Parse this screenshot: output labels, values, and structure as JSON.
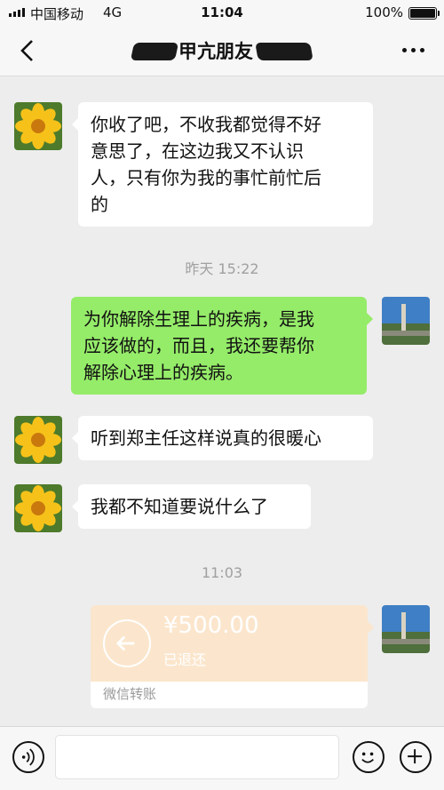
{
  "status_bar": {
    "carrier": "中国移动",
    "network": "4G",
    "time": "11:04",
    "battery_percent": "100%",
    "battery_level": 1.0
  },
  "nav": {
    "title": "甲亢朋友",
    "back_icon": "chevron-left-icon",
    "more_icon": "more-dots-icon"
  },
  "messages": [
    {
      "side": "left",
      "avatar": "sunflower-avatar",
      "text_lines": [
        "你收了吧，不收我都觉得不好",
        "意思了，在这边我又不认识",
        "人，只有你为我的事忙前忙后",
        "的"
      ]
    },
    {
      "type": "timestamp",
      "text": "昨天 15:22"
    },
    {
      "side": "right",
      "avatar": "tower-avatar",
      "text_lines": [
        "为你解除生理上的疾病，是我",
        "应该做的，而且，我还要帮你",
        "解除心理上的疾病。"
      ]
    },
    {
      "side": "left",
      "avatar": "sunflower-avatar",
      "text_lines": [
        "听到郑主任这样说真的很暖心"
      ]
    },
    {
      "side": "left",
      "avatar": "sunflower-avatar",
      "text_lines": [
        "我都不知道要说什么了"
      ]
    },
    {
      "type": "timestamp",
      "text": "11:03"
    }
  ],
  "transfer": {
    "amount": "¥500.00",
    "status": "已退还",
    "footer": "微信转账",
    "icon": "return-arrow-icon",
    "color": "#fbe6cd"
  },
  "input_bar": {
    "voice_icon": "voice-icon",
    "emoji_icon": "emoji-icon",
    "plus_icon": "plus-icon"
  },
  "colors": {
    "background": "#ededed",
    "self_bubble": "#95ec69",
    "other_bubble": "#ffffff"
  }
}
